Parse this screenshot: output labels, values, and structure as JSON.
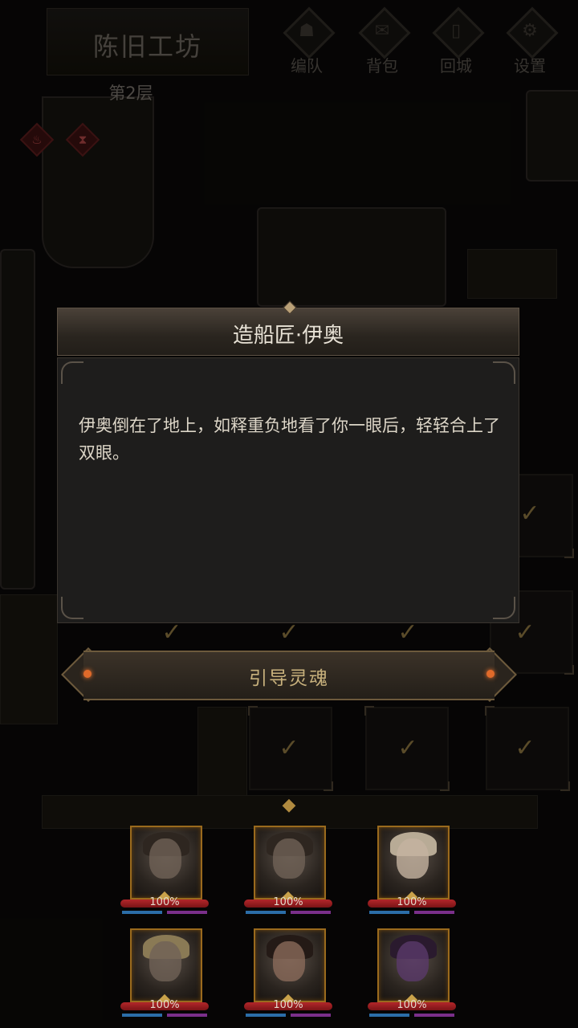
{
  "zone": {
    "title": "陈旧工坊",
    "floor": "第2层"
  },
  "buffs": [
    {
      "name": "fire-buff-icon",
      "glyph": "♨"
    },
    {
      "name": "hourglass-buff-icon",
      "glyph": "⧗"
    }
  ],
  "menu": [
    {
      "id": "team",
      "label": "编队",
      "icon": "helmet-icon",
      "glyph": "☗"
    },
    {
      "id": "bag",
      "label": "背包",
      "icon": "bag-icon",
      "glyph": "✉"
    },
    {
      "id": "return",
      "label": "回城",
      "icon": "door-icon",
      "glyph": "▯"
    },
    {
      "id": "settings",
      "label": "设置",
      "icon": "gear-icon",
      "glyph": "⚙"
    }
  ],
  "dialog": {
    "title": "造船匠·伊奥",
    "text": "伊奥倒在了地上，如释重负地看了你一眼后，轻轻合上了双眼。"
  },
  "action": {
    "label": "引导灵魂"
  },
  "party": [
    {
      "hp": "100%",
      "hp_fraction": 1.0
    },
    {
      "hp": "100%",
      "hp_fraction": 1.0
    },
    {
      "hp": "100%",
      "hp_fraction": 1.0
    },
    {
      "hp": "100%",
      "hp_fraction": 1.0
    },
    {
      "hp": "100%",
      "hp_fraction": 1.0
    },
    {
      "hp": "100%",
      "hp_fraction": 1.0
    }
  ],
  "colors": {
    "accent_gold": "#c9b27d",
    "hp_red": "#b3262a",
    "frame_orange": "#9a6a1d"
  }
}
